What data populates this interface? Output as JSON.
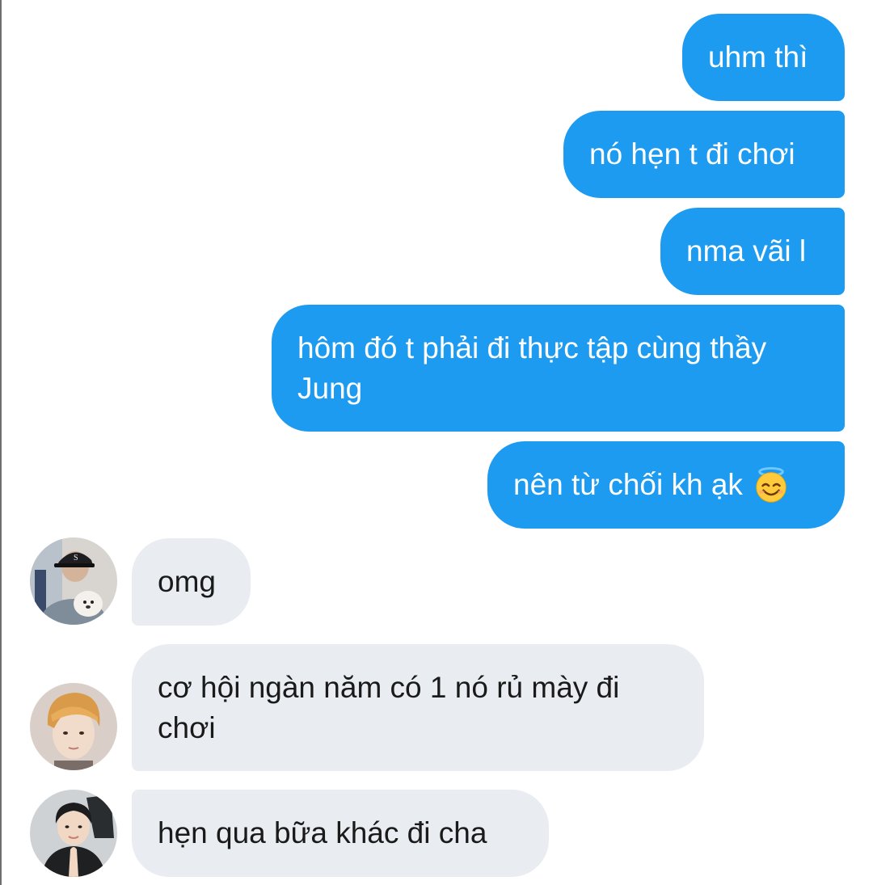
{
  "outgoing": [
    {
      "text": "uhm thì"
    },
    {
      "text": "nó hẹn t đi chơi"
    },
    {
      "text": "nma vãi l"
    },
    {
      "text": "hôm đó t phải đi thực tập cùng thầy Jung"
    },
    {
      "text": "nên từ chối kh ạk",
      "emoji": "smiling-face-with-halo-icon"
    }
  ],
  "incoming": [
    {
      "text": "omg",
      "avatar": "avatar-man-cap-with-dog"
    },
    {
      "text": "cơ hội ngàn năm có 1 nó rủ mày đi chơi",
      "avatar": "avatar-orange-hair-boy"
    },
    {
      "text": "hẹn qua bữa khác đi cha",
      "avatar": "avatar-boy-praying-hands"
    }
  ],
  "colors": {
    "outgoing_bubble": "#1d9bf0",
    "incoming_bubble": "#e9edf1",
    "outgoing_text": "#ffffff",
    "incoming_text": "#1a1a1a"
  }
}
